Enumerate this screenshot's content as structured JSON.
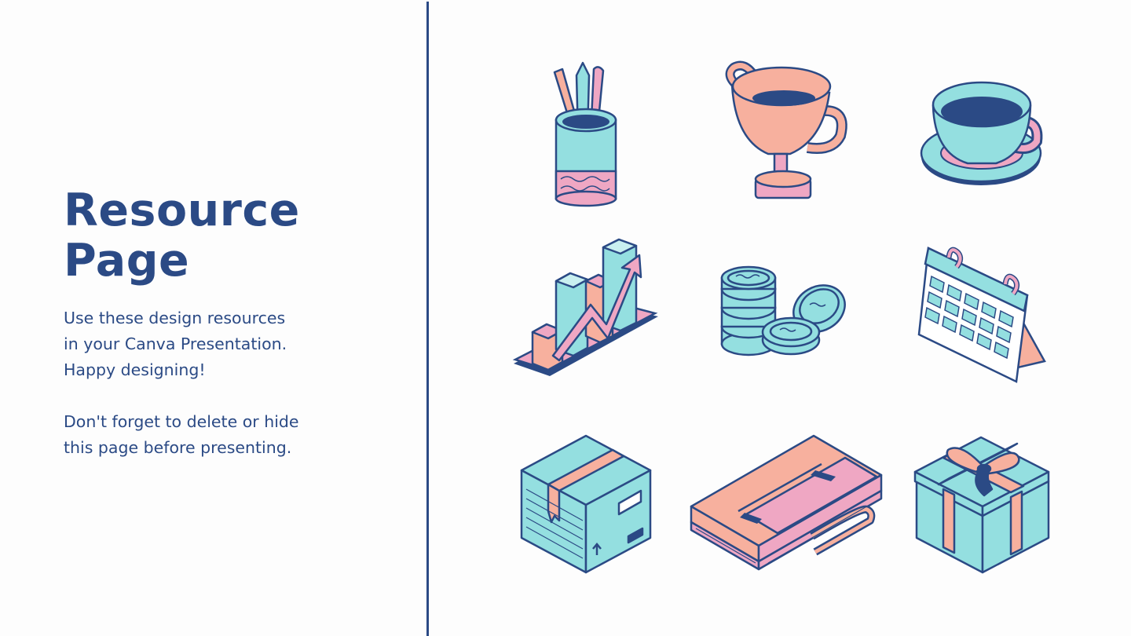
{
  "page": {
    "title_line1": "Resource",
    "title_line2": "Page",
    "body_lines": [
      "Use these design resources",
      "in your Canva Presentation.",
      "Happy designing!"
    ],
    "note_lines": [
      "Don't forget to delete or hide",
      "this page before presenting."
    ]
  },
  "colors": {
    "navy": "#2b4a85",
    "teal": "#94dfe0",
    "peach": "#f7b09e",
    "pink": "#efa7c3",
    "background": "#fdfdfd"
  },
  "icons": [
    "pencil-cup-icon",
    "trophy-cup-icon",
    "coffee-cup-icon",
    "bar-chart-icon",
    "coins-icon",
    "calendar-icon",
    "package-box-icon",
    "briefcase-icon",
    "gift-box-icon"
  ]
}
